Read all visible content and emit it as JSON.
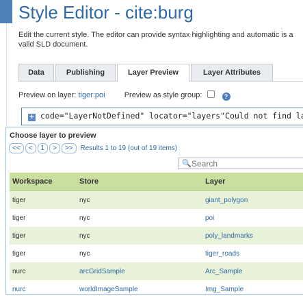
{
  "page": {
    "title": "Style Editor - cite:burg",
    "intro": "Edit the current style. The editor can provide syntax highlighting and automatic is a valid SLD document."
  },
  "tabs": [
    {
      "label": "Data"
    },
    {
      "label": "Publishing"
    },
    {
      "label": "Layer Preview"
    },
    {
      "label": "Layer Attributes"
    }
  ],
  "preview": {
    "layer_label": "Preview on layer:",
    "layer_value": "tiger:poi",
    "group_label": "Preview as style group:",
    "help_symbol": "?"
  },
  "editor": {
    "expand_symbol": "+",
    "error_line": "code=\"LayerNotDefined\" locator=\"layers\"Could not find layer"
  },
  "popup": {
    "title": "Choose layer to preview",
    "pager": {
      "first": "<<",
      "prev": "<",
      "page": "1",
      "next": ">",
      "last": ">>"
    },
    "results": "Results 1 to 19 (out of 19 items)",
    "search_placeholder": "Search",
    "columns": [
      "Workspace",
      "Store",
      "Layer"
    ],
    "rows": [
      {
        "workspace": "tiger",
        "store": "nyc",
        "layer": "giant_polygon"
      },
      {
        "workspace": "tiger",
        "store": "nyc",
        "layer": "poi"
      },
      {
        "workspace": "tiger",
        "store": "nyc",
        "layer": "poly_landmarks"
      },
      {
        "workspace": "tiger",
        "store": "nyc",
        "layer": "tiger_roads"
      },
      {
        "workspace": "nurc",
        "store": "arcGridSample",
        "layer": "Arc_Sample"
      },
      {
        "workspace": "nurc",
        "store": "worldImageSample",
        "layer": "Img_Sample"
      }
    ]
  },
  "colors": {
    "accent": "#2f6aa5",
    "header_green": "#c9dfa0",
    "row_alt": "#e8f2d9"
  }
}
